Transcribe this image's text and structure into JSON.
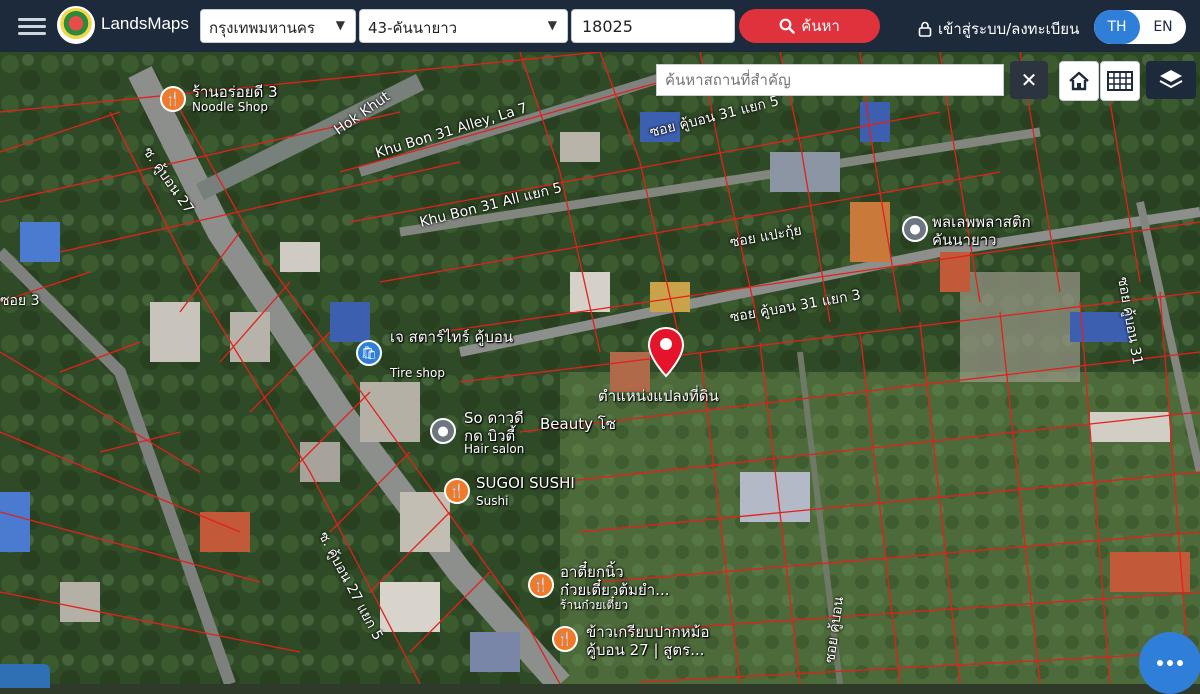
{
  "app": {
    "brand": "LandsMaps"
  },
  "header": {
    "province": "กรุงเทพมหานคร",
    "district": "43-คันนายาว",
    "parcel_number": "18025",
    "search_label": "ค้นหา",
    "login_label": "เข้าสู่ระบบ/ลงทะเบียน",
    "lang_th": "TH",
    "lang_en": "EN"
  },
  "map_controls": {
    "place_search_placeholder": "ค้นหาสถานที่สำคัญ",
    "clear": "✕"
  },
  "marker": {
    "label": "ตำแหน่งแปลงที่ดิน"
  },
  "pois": [
    {
      "name": "ร้านอร่อยดี 3",
      "sub": "Noodle Shop",
      "icon": "food-icon",
      "color": "#f07a2a"
    },
    {
      "name": "เจ สตาร์ไทร์ คู้บอน",
      "sub": "Tire shop",
      "icon": "shop-icon",
      "color": "#2f7fd8"
    },
    {
      "name": "So ดาวดี",
      "sub": "Hair salon",
      "name2": "กด บิวตี้",
      "extra": "Beauty โซ",
      "icon": "salon-icon",
      "color": "#6e7680"
    },
    {
      "name": "SUGOI SUSHI",
      "sub": "Sushi",
      "icon": "food-icon",
      "color": "#f07a2a"
    },
    {
      "name": "อาตี๋ยกนิ้ว",
      "name2": "ก๋วยเตี๋ยวต้มยำ...",
      "sub": "ร้านก๋วยเตี๋ยว",
      "icon": "food-icon",
      "color": "#f07a2a"
    },
    {
      "name": "ข้าวเกรียบปากหม้อ",
      "name2": "คู้บอน 27 | สูตร...",
      "icon": "food-icon",
      "color": "#f07a2a"
    },
    {
      "name": "พลเลพพลาสติก",
      "name2": "คันนายาว",
      "icon": "store-icon",
      "color": "#6e7680"
    }
  ],
  "streets": {
    "s1": "Khu Bon 31 Alley, La 7",
    "s2": "ซอย คู้บอน 31 แยก 5",
    "s3": "Khu Bon 31 All แยก 5",
    "s4": "ซอย แปะกุ้ย",
    "s5": "ซอย คู้บอน 31 แยก 3",
    "s6": "ซ. คู้บอน 27",
    "s7": "ซ. คู้บอน 27 แยก 5",
    "s8": "Hok Khut",
    "s9": "ซอย คู้บอน",
    "s10": "ซอย คู้บอน 31",
    "s11": "ซอย 3"
  },
  "colors": {
    "header": "#1d2a3c",
    "search": "#e0323c",
    "accent": "#2f7fd8",
    "parcel_line": "#e3201b"
  }
}
